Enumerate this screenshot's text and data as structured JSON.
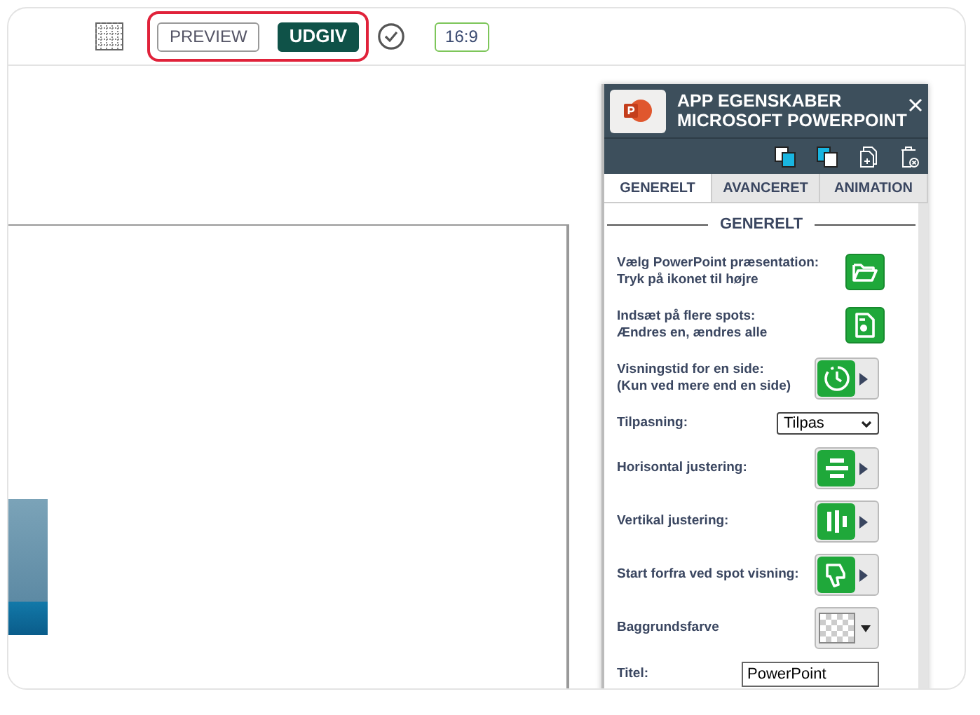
{
  "toolbar": {
    "buttons": [
      {
        "label": "PREVIEW",
        "kind": "outline"
      },
      {
        "label": "UDGIV",
        "kind": "primary"
      }
    ],
    "ratio": "16:9"
  },
  "panel": {
    "title_lines": [
      "APP EGENSKABER",
      "MICROSOFT POWERPOINT"
    ],
    "tabs": [
      {
        "label": "GENERELT",
        "selected": true
      },
      {
        "label": "AVANCERET",
        "selected": false
      },
      {
        "label": "ANIMATION",
        "selected": false
      }
    ],
    "section": "GENERELT",
    "rows": [
      {
        "kind": "button",
        "lines": [
          "Vælg PowerPoint præsentation:",
          "Tryk på ikonet til højre"
        ]
      },
      {
        "kind": "button",
        "lines": [
          "Indsæt på flere spots:",
          "Ændres en, ændres alle"
        ]
      },
      {
        "kind": "dropdown",
        "lines": [
          "Visningstid for en side:",
          "(Kun ved mere end en side)"
        ]
      },
      {
        "kind": "select",
        "lines": [
          "Tilpasning:"
        ],
        "value": "Tilpas"
      },
      {
        "kind": "dropdown",
        "lines": [
          "Horisontal justering:"
        ]
      },
      {
        "kind": "dropdown",
        "lines": [
          "Vertikal justering:"
        ]
      },
      {
        "kind": "dropdown",
        "lines": [
          "Start forfra ved spot visning:"
        ]
      },
      {
        "kind": "color",
        "lines": [
          "Baggrundsfarve"
        ]
      },
      {
        "kind": "text",
        "lines": [
          "Titel:"
        ],
        "value": "PowerPoint"
      }
    ]
  }
}
